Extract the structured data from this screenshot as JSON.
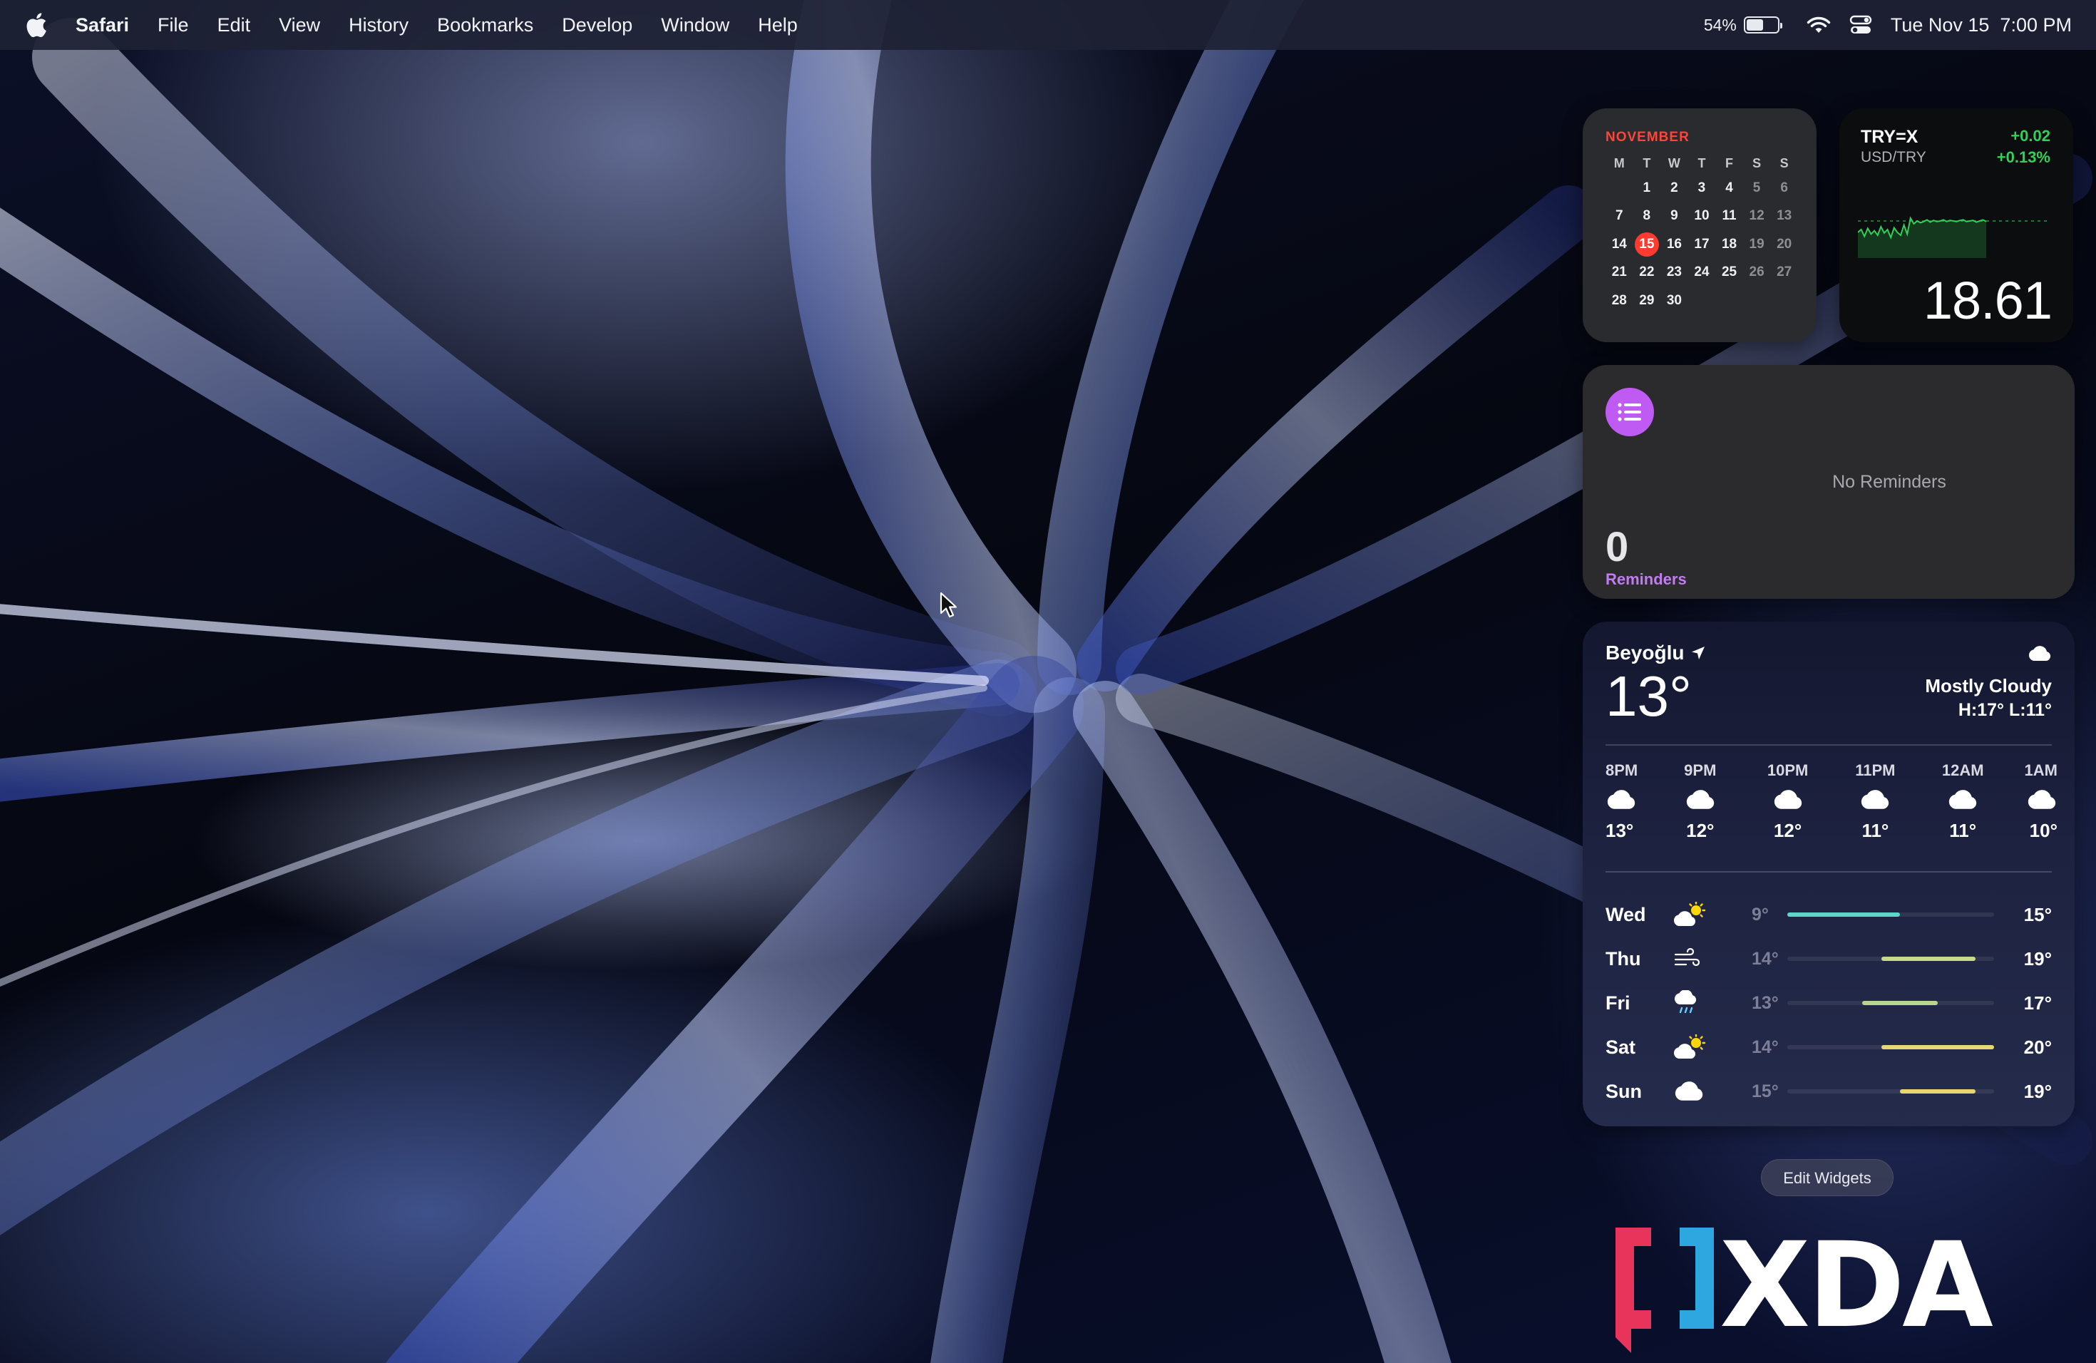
{
  "menubar": {
    "apple": "apple-logo-icon",
    "app_name": "Safari",
    "menus": [
      "File",
      "Edit",
      "View",
      "History",
      "Bookmarks",
      "Develop",
      "Window",
      "Help"
    ],
    "battery_percent": "54%",
    "battery_level": 0.54,
    "wifi": "wifi-icon",
    "control_center": "control-center-icon",
    "datetime": "Tue Nov 15  7:00 PM"
  },
  "calendar": {
    "month": "NOVEMBER",
    "weekdays": [
      "M",
      "T",
      "W",
      "T",
      "F",
      "S",
      "S"
    ],
    "weeks": [
      [
        "",
        "1",
        "2",
        "3",
        "4",
        "5",
        "6"
      ],
      [
        "7",
        "8",
        "9",
        "10",
        "11",
        "12",
        "13"
      ],
      [
        "14",
        "15",
        "16",
        "17",
        "18",
        "19",
        "20"
      ],
      [
        "21",
        "22",
        "23",
        "24",
        "25",
        "26",
        "27"
      ],
      [
        "28",
        "29",
        "30",
        "",
        "",
        "",
        ""
      ]
    ],
    "today": "15",
    "today_color": "#ff3b30"
  },
  "stocks": {
    "symbol": "TRY=X",
    "name": "USD/TRY",
    "change": "+0.02",
    "change_percent": "+0.13%",
    "price": "18.61",
    "up_color": "#30d158",
    "sparkline": [
      0.55,
      0.5,
      0.62,
      0.48,
      0.58,
      0.52,
      0.6,
      0.45,
      0.56,
      0.5,
      0.64,
      0.47,
      0.55,
      0.6,
      0.42,
      0.58,
      0.3,
      0.4,
      0.35,
      0.38,
      0.36,
      0.33,
      0.37,
      0.34,
      0.36,
      0.35,
      0.33,
      0.36,
      0.34,
      0.35,
      0.36,
      0.34,
      0.33,
      0.36,
      0.35,
      0.34,
      0.37,
      0.35,
      0.33,
      0.36
    ]
  },
  "reminders": {
    "icon": "list-icon",
    "empty_text": "No Reminders",
    "count": "0",
    "label": "Reminders",
    "accent": "#bf5af2"
  },
  "weather": {
    "location": "Beyoğlu",
    "location_icon": "location-arrow-icon",
    "temperature": "13°",
    "condition": "Mostly Cloudy",
    "condition_icon": "cloud-icon",
    "high_low": "H:17° L:11°",
    "hourly": [
      {
        "time": "8PM",
        "icon": "cloud-icon",
        "temp": "13°"
      },
      {
        "time": "9PM",
        "icon": "cloud-icon",
        "temp": "12°"
      },
      {
        "time": "10PM",
        "icon": "cloud-icon",
        "temp": "12°"
      },
      {
        "time": "11PM",
        "icon": "cloud-icon",
        "temp": "11°"
      },
      {
        "time": "12AM",
        "icon": "cloud-icon",
        "temp": "11°"
      },
      {
        "time": "1AM",
        "icon": "cloud-icon",
        "temp": "10°"
      }
    ],
    "range_min": 9,
    "range_max": 20,
    "daily": [
      {
        "day": "Wed",
        "icon": "partly-sunny-icon",
        "low": "9°",
        "high": "15°",
        "low_v": 9,
        "high_v": 15,
        "color": "#5fd4c8"
      },
      {
        "day": "Thu",
        "icon": "wind-icon",
        "low": "14°",
        "high": "19°",
        "low_v": 14,
        "high_v": 19,
        "color": "#c9d98a"
      },
      {
        "day": "Fri",
        "icon": "rain-icon",
        "low": "13°",
        "high": "17°",
        "low_v": 13,
        "high_v": 17,
        "color": "#b8d68e"
      },
      {
        "day": "Sat",
        "icon": "partly-sunny-icon",
        "low": "14°",
        "high": "20°",
        "low_v": 14,
        "high_v": 20,
        "color": "#e6d674"
      },
      {
        "day": "Sun",
        "icon": "cloud-icon",
        "low": "15°",
        "high": "19°",
        "low_v": 15,
        "high_v": 19,
        "color": "#e5d873"
      }
    ]
  },
  "edit_widgets_label": "Edit Widgets",
  "watermark": "XDA",
  "cursor": "pointer-cursor-icon"
}
